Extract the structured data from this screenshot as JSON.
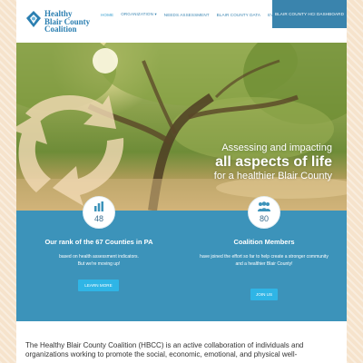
{
  "header": {
    "logo": {
      "line1": "Healthy",
      "line2": "Blair County",
      "line3": "Coalition"
    },
    "nav": [
      {
        "label": "HOME"
      },
      {
        "label": "ORGANIZATION ▾"
      },
      {
        "label": "NEEDS ASSESSMENT"
      },
      {
        "label": "BLAIR COUNTY DATA"
      },
      {
        "label": "EVENTS"
      }
    ],
    "cta_label": "BLAIR COUNTY HCI DASHBOARD"
  },
  "hero": {
    "line1": "Assessing and impacting",
    "line2": "all aspects of life",
    "line3": "for a healthier Blair County"
  },
  "stats": {
    "rank": {
      "value": "48",
      "title": "Our rank of the 67 Counties in PA",
      "desc1": "based on health assessment indicators.",
      "desc2": "But we're moving up!",
      "button": "LEARN MORE"
    },
    "members": {
      "value": "80",
      "title": "Coalition Members",
      "desc1": "have joined the effort so far to help create a stronger community",
      "desc2": "and a healthier Blair County!",
      "button": "JOIN US"
    }
  },
  "intro": {
    "text": "The Healthy Blair County Coalition (HBCC) is an active collaboration of individuals and organizations working to promote the social, economic, emotional, and physical well-"
  },
  "colors": {
    "brand_blue": "#2b7fb1",
    "stats_bg": "#3c93ba",
    "button_blue": "#2fb5e6",
    "page_bg": "#f6e3cc"
  },
  "icons": {
    "logo": "hbcc-logo-icon",
    "rank": "bar-chart-icon",
    "members": "people-icon",
    "hero_decor": "recycle-arrows-icon"
  }
}
